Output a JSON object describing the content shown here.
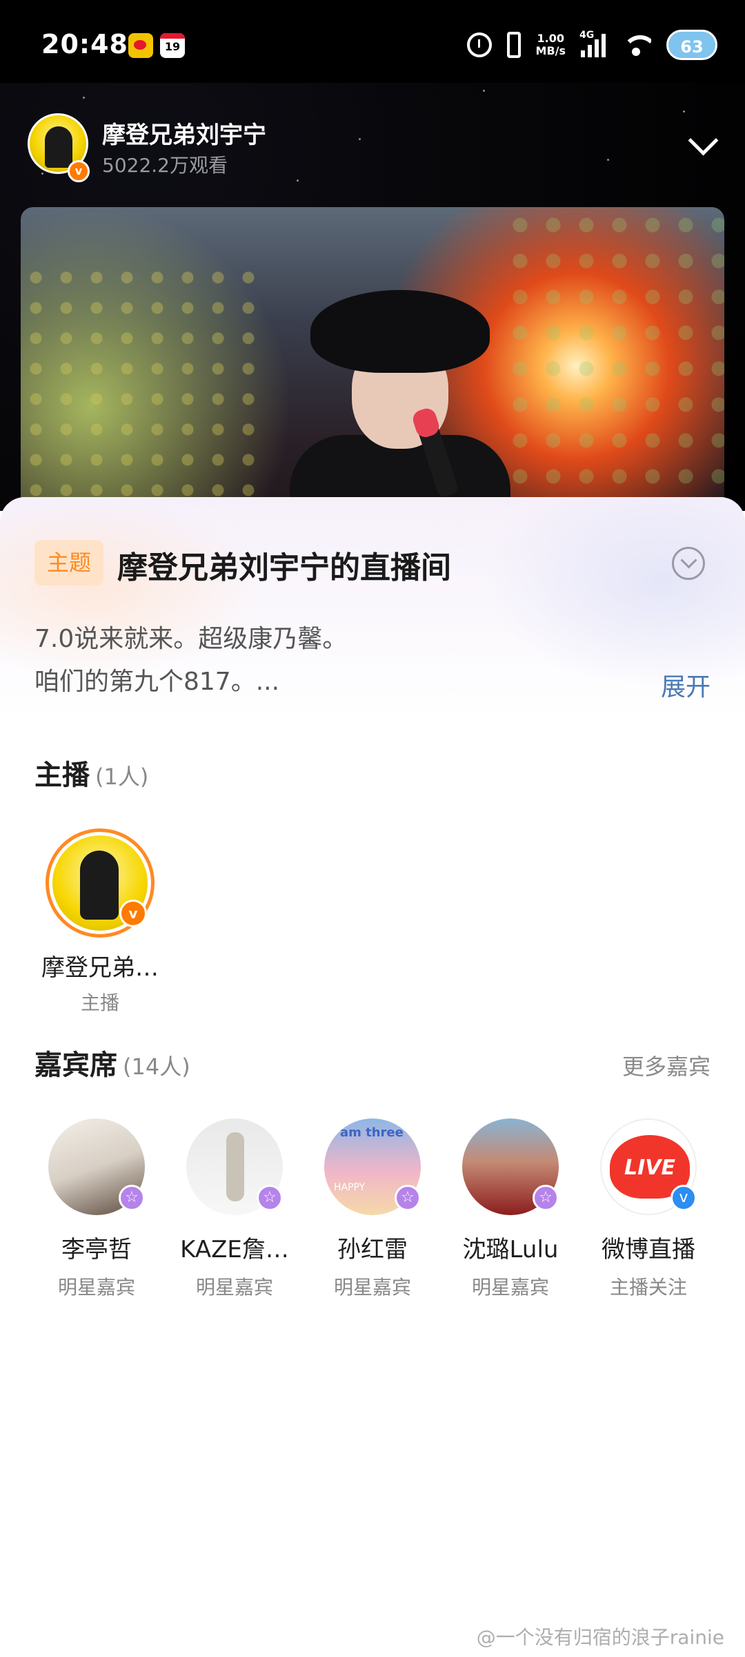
{
  "status_bar": {
    "time": "20:48",
    "calendar_day": "19",
    "net_speed_value": "1.00",
    "net_speed_unit": "MB/s",
    "network": "4G",
    "battery": "63"
  },
  "header": {
    "name": "摩登兄弟刘宇宁",
    "views": "5022.2万观看",
    "badge": "v"
  },
  "room": {
    "tag": "主题",
    "title": "摩登兄弟刘宇宁的直播间",
    "desc_line1": "7.0说来就来。超级康乃馨。",
    "desc_line2": "咱们的第九个817。...",
    "expand_label": "展开"
  },
  "host_section": {
    "title": "主播",
    "count": "(1人)",
    "host": {
      "name": "摩登兄弟刘宇宁",
      "name_display": "摩登兄弟…",
      "role": "主播",
      "badge": "v"
    }
  },
  "guest_section": {
    "title": "嘉宾席",
    "count": "(14人)",
    "more_label": "更多嘉宾",
    "guests": [
      {
        "name": "李亭哲",
        "role": "明星嘉宾",
        "badge": "☆"
      },
      {
        "name": "KAZE詹…",
        "role": "明星嘉宾",
        "badge": "☆"
      },
      {
        "name": "孙红雷",
        "role": "明星嘉宾",
        "badge": "☆",
        "avatar_text": "I am three",
        "avatar_text2": "HAPPY"
      },
      {
        "name": "沈璐Lulu",
        "role": "明星嘉宾",
        "badge": "☆"
      },
      {
        "name": "微博直播",
        "role": "主播关注",
        "badge": "v",
        "avatar_text": "LIVE"
      }
    ]
  },
  "watermark": "@一个没有归宿的浪子rainie",
  "colors": {
    "accent_orange": "#ff8a22",
    "link_blue": "#4b79b4",
    "star_badge": "#b583ea",
    "verified_blue": "#2b8ef0"
  }
}
